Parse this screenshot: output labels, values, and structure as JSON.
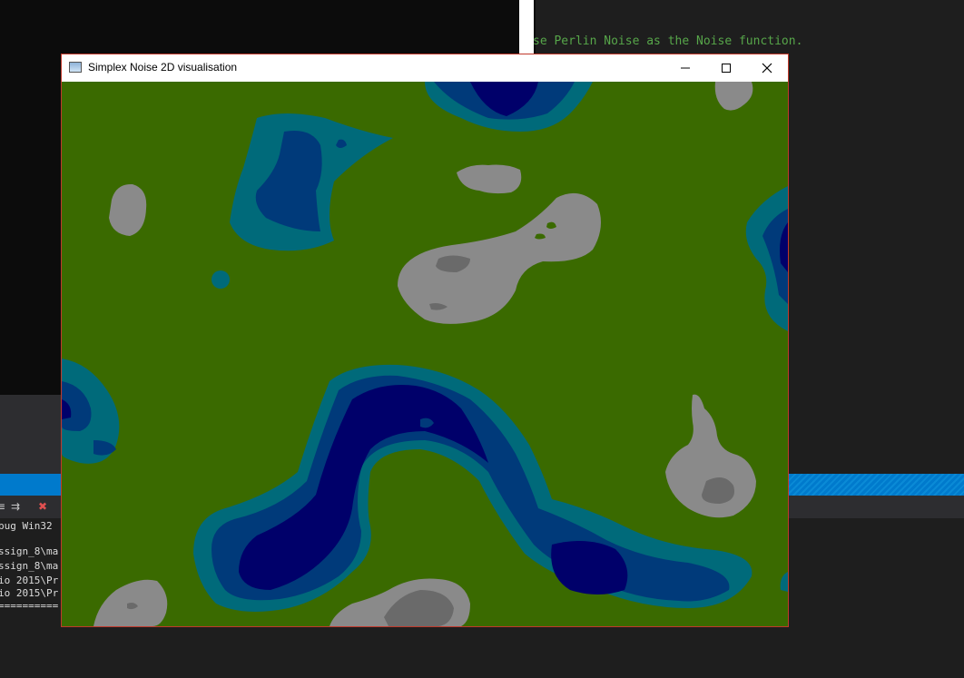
{
  "editor": {
    "code_line": "se Perlin Noise as the Noise function."
  },
  "output": {
    "lines": [
      "bug Win32",
      "",
      "ssign_8\\ma",
      "ssign_8\\ma",
      "io 2015\\Pr",
      "io 2015\\Pr",
      "=========="
    ]
  },
  "window": {
    "title": "Simplex Noise 2D visualisation",
    "minimize_icon": "minimize-icon",
    "maximize_icon": "maximize-icon",
    "close_icon": "close-icon"
  },
  "terrain_colors": {
    "grass": "#3a6a00",
    "shallow_water": "#006a7a",
    "mid_water": "#003a7a",
    "deep_water": "#00006a",
    "rock": "#8a8a8a",
    "dark_rock": "#6a6a6a"
  }
}
